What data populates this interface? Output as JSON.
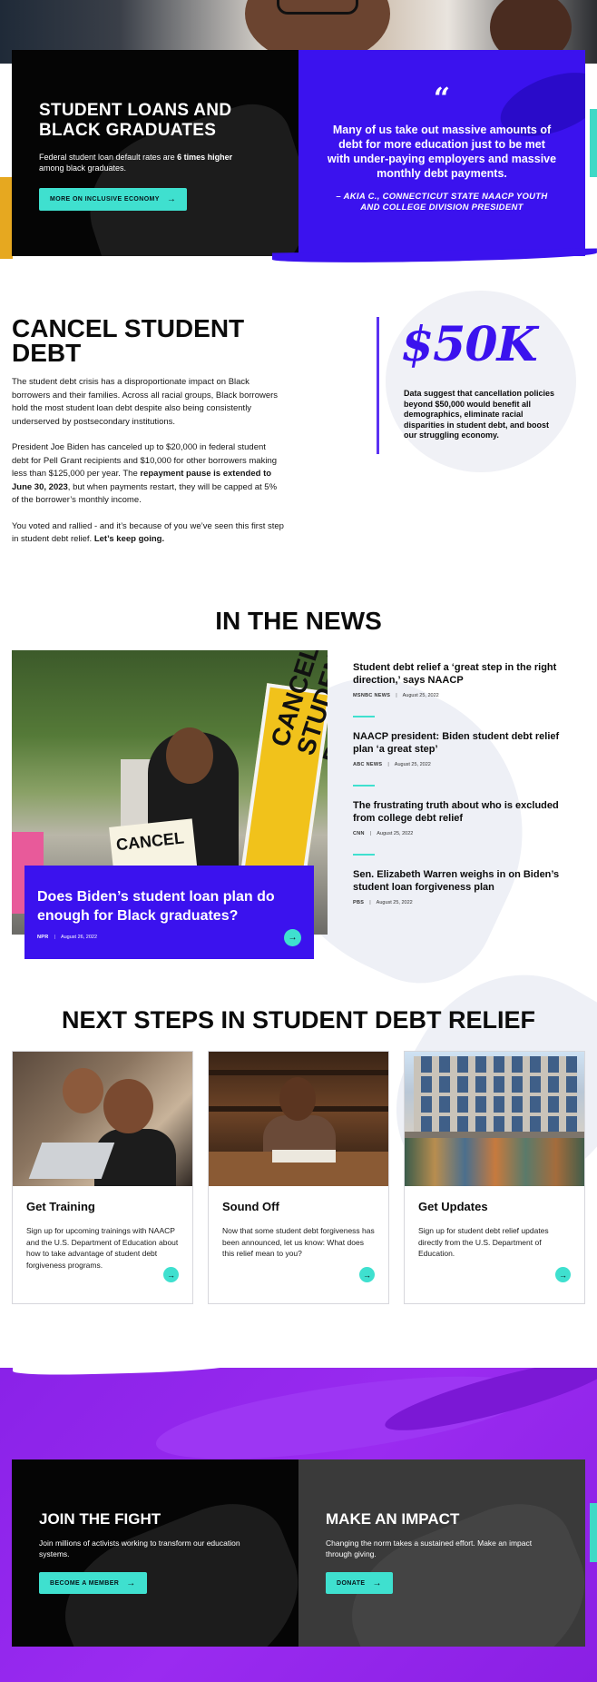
{
  "hero": {
    "title": "STUDENT LOANS AND BLACK GRADUATES",
    "subtitle_before": "Federal student loan default rates are ",
    "subtitle_bold": "6 times higher",
    "subtitle_after": " among black graduates.",
    "button_label": "MORE ON INCLUSIVE ECONOMY",
    "quote_mark": "“",
    "quote": "Many of us take out massive amounts of debt for more education just to be met with under-paying employers and massive monthly debt payments.",
    "attribution": "– AKIA C., CONNECTICUT STATE NAACP YOUTH AND COLLEGE DIVISION PRESIDENT"
  },
  "cancel": {
    "title": "CANCEL STUDENT DEBT",
    "p1": "The student debt crisis has a disproportionate impact on Black borrowers and their families. Across all racial groups, Black borrowers hold the most student loan debt despite also being consistently underserved by postsecondary institutions.",
    "p2_a": "President Joe Biden has canceled up to $20,000 in federal student debt for Pell Grant recipients and $10,000 for other borrowers making less than $125,000 per year. The ",
    "p2_bold": "repayment pause is extended to June 30, 2023",
    "p2_b": ", but when payments restart, they will be capped at 5% of the borrower’s monthly income.",
    "p3_a": "You voted and rallied - and it’s because of you we’ve seen this first step in student debt relief. ",
    "p3_bold": "Let’s keep going.",
    "stat": "$50K",
    "stat_text": "Data suggest that cancellation policies beyond $50,000 would benefit all demographics, eliminate racial disparities in student debt, and boost our struggling economy."
  },
  "news": {
    "title": "IN THE NEWS",
    "photo_sign1": "CANCEL STUDENT DEBT",
    "photo_sign2": "CANCEL",
    "feature": {
      "headline": "Does Biden’s student loan plan do enough for Black graduates?",
      "source": "NPR",
      "date": "August 26, 2022"
    },
    "items": [
      {
        "headline": "Student debt relief a ‘great step in the right direction,’ says NAACP",
        "source": "MSNBC NEWS",
        "date": "August 25, 2022"
      },
      {
        "headline": "NAACP president: Biden student debt relief plan ‘a great step’",
        "source": "ABC NEWS",
        "date": "August 25, 2022"
      },
      {
        "headline": "The frustrating truth about who is excluded from college debt relief",
        "source": "CNN",
        "date": "August 25, 2022"
      },
      {
        "headline": "Sen. Elizabeth Warren weighs in on Biden’s student loan forgiveness plan",
        "source": "PBS",
        "date": "August 25, 2022"
      }
    ],
    "separator": "|"
  },
  "steps": {
    "title": "NEXT STEPS IN STUDENT DEBT RELIEF",
    "cards": [
      {
        "title": "Get Training",
        "body": "Sign up for upcoming trainings with NAACP and the U.S. Department of Education about how to take advantage of student debt forgiveness programs."
      },
      {
        "title": "Sound Off",
        "body": "Now that some student debt forgiveness has been announced, let us know: What does this relief mean to you?"
      },
      {
        "title": "Get Updates",
        "body": "Sign up for student debt relief updates directly from the U.S. Department of Education."
      }
    ]
  },
  "join": {
    "left": {
      "title": "JOIN THE FIGHT",
      "sub": "Join millions of activists working to transform our education systems.",
      "button": "BECOME A MEMBER"
    },
    "right": {
      "title": "MAKE AN IMPACT",
      "sub": "Changing the norm takes a sustained effort. Make an impact through giving.",
      "button": "DONATE"
    }
  },
  "icons": {
    "arrow": "→",
    "arrow_icon": "arrow-right-icon"
  },
  "colors": {
    "accent_blue": "#3b12ee",
    "accent_cyan": "#3fe0cf",
    "purple": "#8a22e8",
    "black": "#050505"
  }
}
